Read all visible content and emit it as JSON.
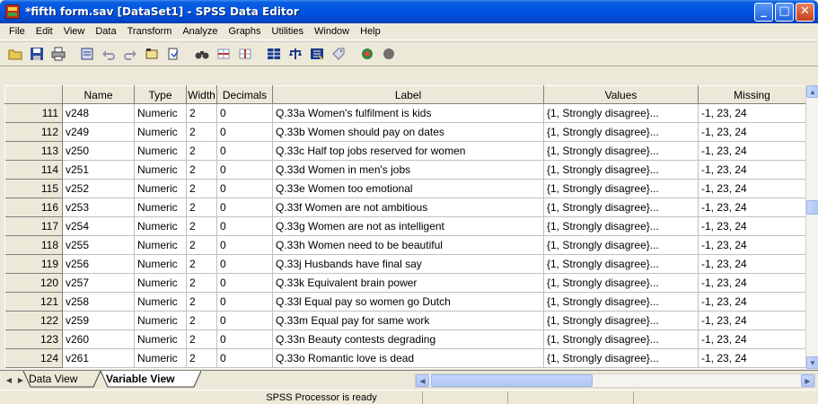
{
  "window": {
    "title": "*fifth form.sav [DataSet1] - SPSS Data Editor",
    "min": "_",
    "max": "□",
    "close": "✕"
  },
  "menu": [
    "File",
    "Edit",
    "View",
    "Data",
    "Transform",
    "Analyze",
    "Graphs",
    "Utilities",
    "Window",
    "Help"
  ],
  "columns": [
    "Name",
    "Type",
    "Width",
    "Decimals",
    "Label",
    "Values",
    "Missing"
  ],
  "rows": [
    {
      "num": "111",
      "name": "v248",
      "type": "Numeric",
      "width": "2",
      "decimals": "0",
      "label": "Q.33a Women's fulfilment is kids",
      "values": "{1, Strongly disagree}...",
      "missing": "-1, 23, 24"
    },
    {
      "num": "112",
      "name": "v249",
      "type": "Numeric",
      "width": "2",
      "decimals": "0",
      "label": "Q.33b Women should pay on dates",
      "values": "{1, Strongly disagree}...",
      "missing": "-1, 23, 24"
    },
    {
      "num": "113",
      "name": "v250",
      "type": "Numeric",
      "width": "2",
      "decimals": "0",
      "label": "Q.33c Half top jobs reserved for women",
      "values": "{1, Strongly disagree}...",
      "missing": "-1, 23, 24"
    },
    {
      "num": "114",
      "name": "v251",
      "type": "Numeric",
      "width": "2",
      "decimals": "0",
      "label": "Q.33d Women in men's jobs",
      "values": "{1, Strongly disagree}...",
      "missing": "-1, 23, 24"
    },
    {
      "num": "115",
      "name": "v252",
      "type": "Numeric",
      "width": "2",
      "decimals": "0",
      "label": "Q.33e Women too emotional",
      "values": "{1, Strongly disagree}...",
      "missing": "-1, 23, 24"
    },
    {
      "num": "116",
      "name": "v253",
      "type": "Numeric",
      "width": "2",
      "decimals": "0",
      "label": "Q.33f Women are not ambitious",
      "values": "{1, Strongly disagree}...",
      "missing": "-1, 23, 24"
    },
    {
      "num": "117",
      "name": "v254",
      "type": "Numeric",
      "width": "2",
      "decimals": "0",
      "label": "Q.33g Women are not as intelligent",
      "values": "{1, Strongly disagree}...",
      "missing": "-1, 23, 24"
    },
    {
      "num": "118",
      "name": "v255",
      "type": "Numeric",
      "width": "2",
      "decimals": "0",
      "label": "Q.33h Women need to be beautiful",
      "values": "{1, Strongly disagree}...",
      "missing": "-1, 23, 24"
    },
    {
      "num": "119",
      "name": "v256",
      "type": "Numeric",
      "width": "2",
      "decimals": "0",
      "label": "Q.33j Husbands have final say",
      "values": "{1, Strongly disagree}...",
      "missing": "-1, 23, 24"
    },
    {
      "num": "120",
      "name": "v257",
      "type": "Numeric",
      "width": "2",
      "decimals": "0",
      "label": "Q.33k Equivalent brain power",
      "values": "{1, Strongly disagree}...",
      "missing": "-1, 23, 24"
    },
    {
      "num": "121",
      "name": "v258",
      "type": "Numeric",
      "width": "2",
      "decimals": "0",
      "label": "Q.33l Equal pay so women go Dutch",
      "values": "{1, Strongly disagree}...",
      "missing": "-1, 23, 24"
    },
    {
      "num": "122",
      "name": "v259",
      "type": "Numeric",
      "width": "2",
      "decimals": "0",
      "label": "Q.33m Equal pay for same work",
      "values": "{1, Strongly disagree}...",
      "missing": "-1, 23, 24"
    },
    {
      "num": "123",
      "name": "v260",
      "type": "Numeric",
      "width": "2",
      "decimals": "0",
      "label": "Q.33n Beauty contests degrading",
      "values": "{1, Strongly disagree}...",
      "missing": "-1, 23, 24"
    },
    {
      "num": "124",
      "name": "v261",
      "type": "Numeric",
      "width": "2",
      "decimals": "0",
      "label": "Q.33o Romantic love is dead",
      "values": "{1, Strongly disagree}...",
      "missing": "-1, 23, 24"
    }
  ],
  "tabs": {
    "data_view": "Data View",
    "variable_view": "Variable View"
  },
  "status": "SPSS Processor is ready"
}
